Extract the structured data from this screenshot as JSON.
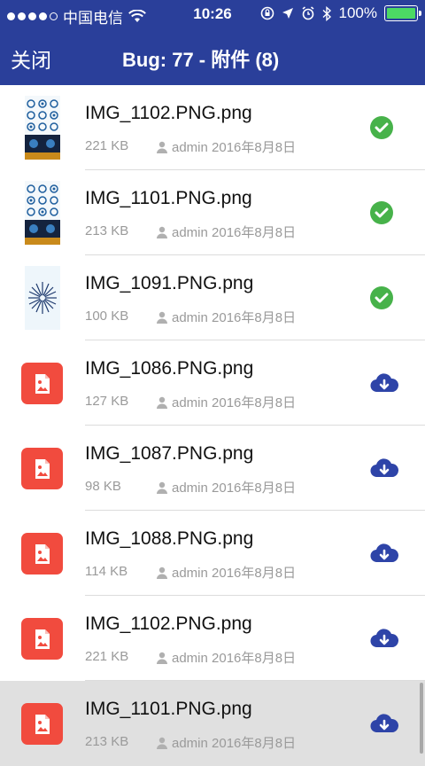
{
  "status_bar": {
    "carrier": "中国电信",
    "time": "10:26",
    "battery_percent": "100%",
    "signal_bars": 4
  },
  "nav": {
    "close_label": "关闭",
    "title": "Bug: 77 - 附件 (8)"
  },
  "colors": {
    "nav_bg": "#2a3f9a",
    "download_blue": "#2e44a8",
    "done_green": "#47b24a",
    "file_red": "#f14b3e"
  },
  "attachments": [
    {
      "name": "IMG_1102.PNG.png",
      "size": "221 KB",
      "uploader_date": "admin 2016年8月8日",
      "status": "downloaded",
      "thumb": "grid"
    },
    {
      "name": "IMG_1101.PNG.png",
      "size": "213 KB",
      "uploader_date": "admin 2016年8月8日",
      "status": "downloaded",
      "thumb": "grid"
    },
    {
      "name": "IMG_1091.PNG.png",
      "size": "100 KB",
      "uploader_date": "admin 2016年8月8日",
      "status": "downloaded",
      "thumb": "burst"
    },
    {
      "name": "IMG_1086.PNG.png",
      "size": "127 KB",
      "uploader_date": "admin 2016年8月8日",
      "status": "download",
      "thumb": "file-image-icon"
    },
    {
      "name": "IMG_1087.PNG.png",
      "size": "98 KB",
      "uploader_date": "admin 2016年8月8日",
      "status": "download",
      "thumb": "file-image-icon"
    },
    {
      "name": "IMG_1088.PNG.png",
      "size": "114 KB",
      "uploader_date": "admin 2016年8月8日",
      "status": "download",
      "thumb": "file-image-icon"
    },
    {
      "name": "IMG_1102.PNG.png",
      "size": "221 KB",
      "uploader_date": "admin 2016年8月8日",
      "status": "download",
      "thumb": "file-image-icon"
    },
    {
      "name": "IMG_1101.PNG.png",
      "size": "213 KB",
      "uploader_date": "admin 2016年8月8日",
      "status": "download",
      "thumb": "file-image-icon"
    }
  ]
}
